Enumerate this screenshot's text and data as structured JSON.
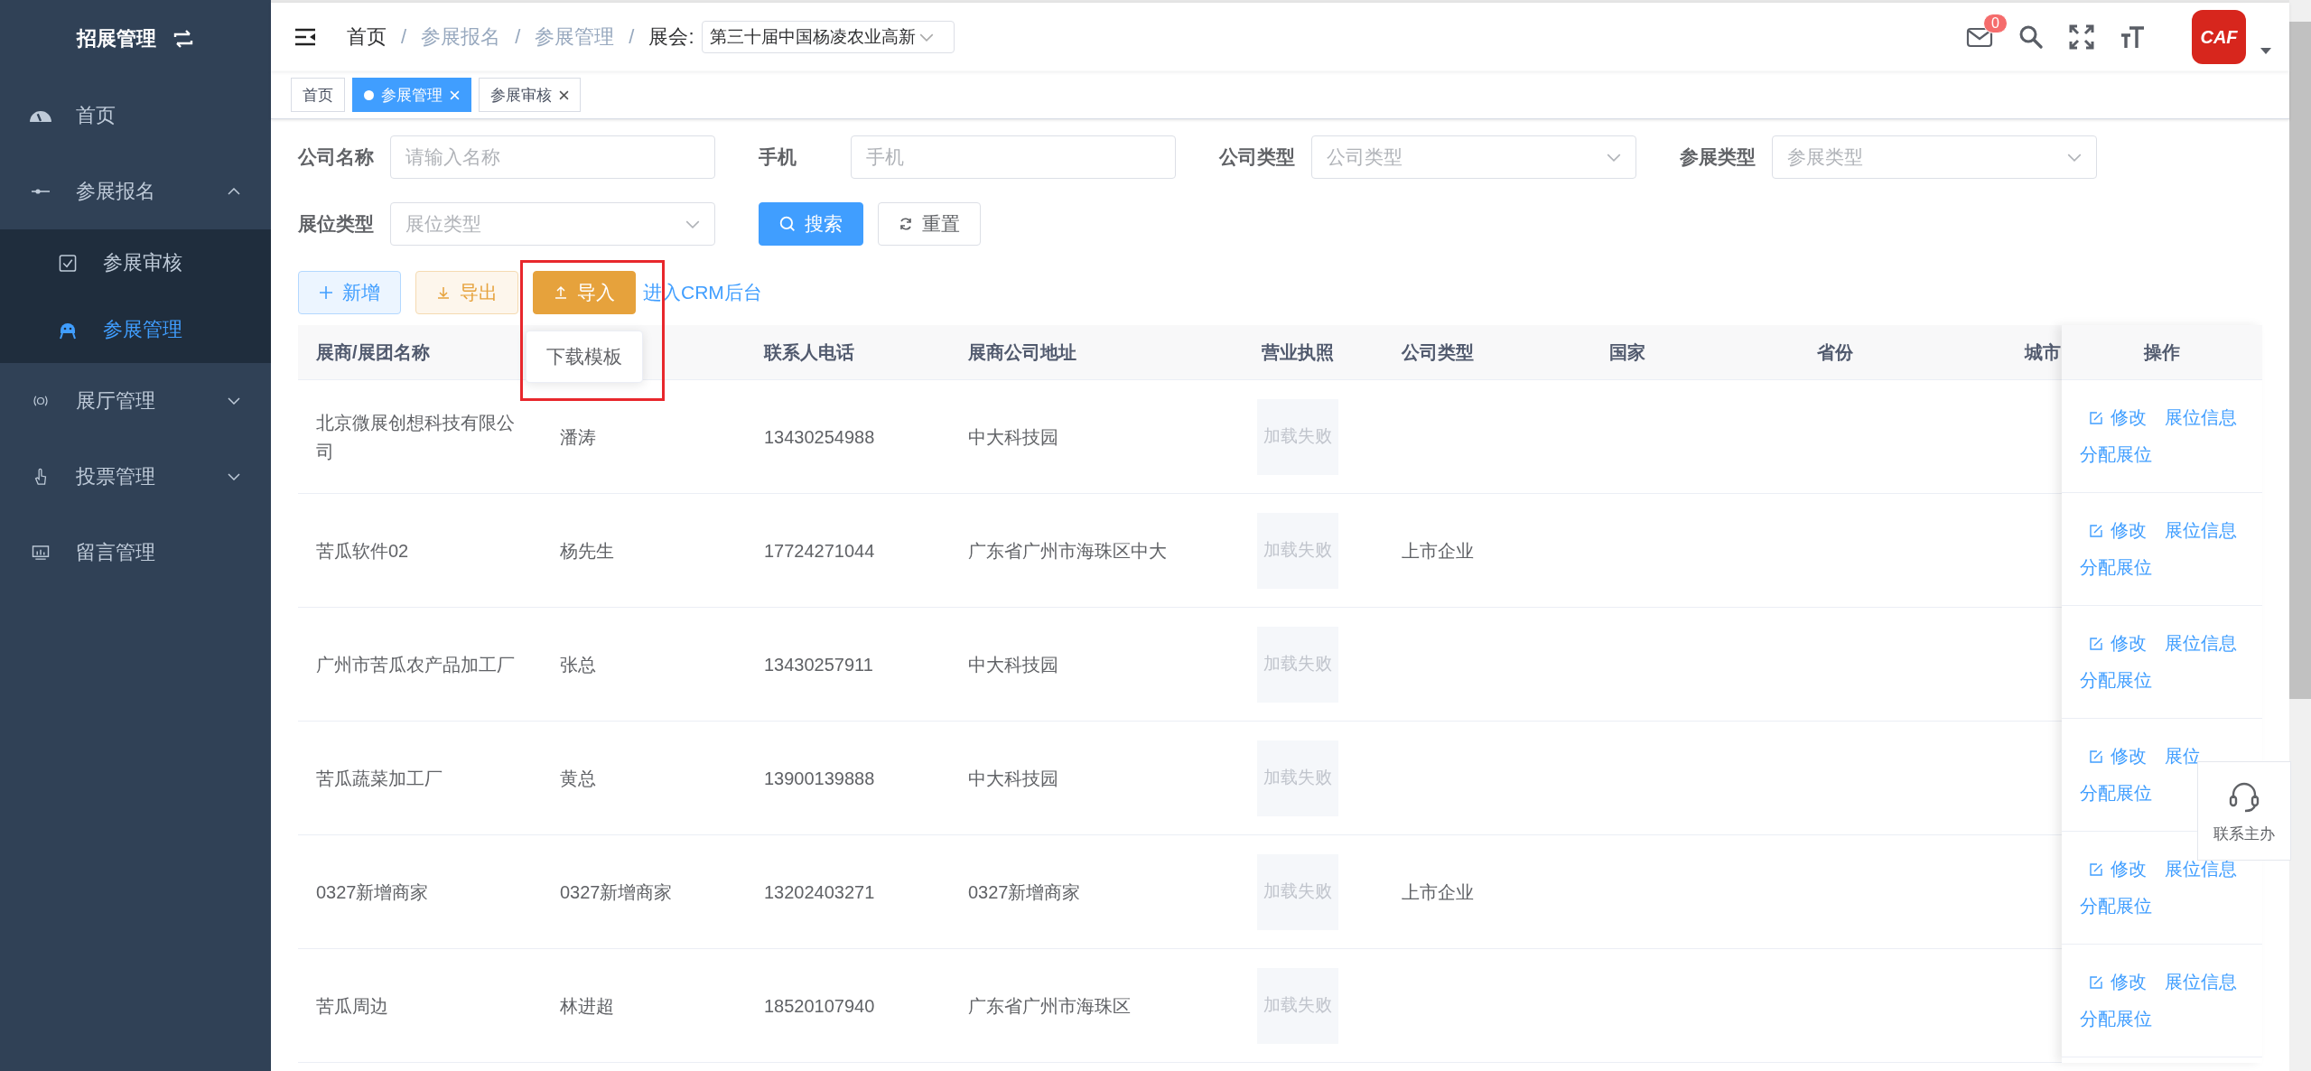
{
  "sidebar": {
    "title": "招展管理",
    "items": [
      {
        "label": "首页",
        "kind": "gauge",
        "selected": false
      },
      {
        "label": "参展报名",
        "kind": "slider",
        "selected": false,
        "expanded": true,
        "children": [
          {
            "label": "参展审核",
            "kind": "checkbox",
            "selected": false
          },
          {
            "label": "参展管理",
            "kind": "robot",
            "selected": true
          }
        ]
      },
      {
        "label": "展厅管理",
        "kind": "broadcast",
        "selected": false,
        "expanded": false
      },
      {
        "label": "投票管理",
        "kind": "hand",
        "selected": false,
        "expanded": false
      },
      {
        "label": "留言管理",
        "kind": "monitor",
        "selected": false
      }
    ]
  },
  "header": {
    "breadcrumb": [
      {
        "label": "首页",
        "muted": false
      },
      {
        "label": "参展报名",
        "muted": true
      },
      {
        "label": "参展管理",
        "muted": true
      }
    ],
    "separator": "/",
    "exhibition_label": "展会:",
    "exhibition_value": "第三十届中国杨凌农业高新",
    "notification_count": "0",
    "logo": "CAF"
  },
  "tags": [
    {
      "label": "首页",
      "selected": false,
      "closable": false
    },
    {
      "label": "参展管理",
      "selected": true,
      "closable": true
    },
    {
      "label": "参展审核",
      "selected": false,
      "closable": true
    }
  ],
  "filters": [
    {
      "label": "公司名称",
      "kind": "input",
      "placeholder": "请输入名称"
    },
    {
      "label": "手机",
      "kind": "input",
      "placeholder": "手机"
    },
    {
      "label": "公司类型",
      "kind": "select",
      "placeholder": "公司类型"
    },
    {
      "label": "参展类型",
      "kind": "select",
      "placeholder": "参展类型"
    },
    {
      "label": "展位类型",
      "kind": "select",
      "placeholder": "展位类型"
    }
  ],
  "filter_buttons": [
    {
      "label": "搜索",
      "kind": "search"
    },
    {
      "label": "重置",
      "kind": "reset"
    }
  ],
  "actions": [
    {
      "label": "新增",
      "kind": "add"
    },
    {
      "label": "导出",
      "kind": "export"
    },
    {
      "label": "导入",
      "kind": "import",
      "highlighted": true,
      "popover": "下载模板"
    },
    {
      "label": "进入CRM后台",
      "kind": "link"
    }
  ],
  "table": {
    "columns": [
      {
        "label": "展商/展团名称"
      },
      {},
      {
        "label": "联系人电话"
      },
      {
        "label": "展商公司地址"
      },
      {
        "label": "营业执照"
      },
      {
        "label": "公司类型"
      },
      {
        "label": "国家"
      },
      {
        "label": "省份"
      },
      {
        "label": "城市"
      }
    ],
    "actions_header": "操作",
    "rows": [
      {
        "name": "北京微展创想科技有限公司",
        "contact": "潘涛",
        "phone": "13430254988",
        "address": "中大科技园",
        "license": "加载失败",
        "actions": [
          "修改",
          "展位信息",
          "分配展位"
        ]
      },
      {
        "name": "苦瓜软件02",
        "contact": "杨先生",
        "phone": "17724271044",
        "address": "广东省广州市海珠区中大",
        "license": "加载失败",
        "company_type": "上市企业",
        "actions": [
          "修改",
          "展位信息",
          "分配展位"
        ]
      },
      {
        "name": "广州市苦瓜农产品加工厂",
        "contact": "张总",
        "phone": "13430257911",
        "address": "中大科技园",
        "license": "加载失败",
        "actions": [
          "修改",
          "展位信息",
          "分配展位"
        ]
      },
      {
        "name": "苦瓜蔬菜加工厂",
        "contact": "黄总",
        "phone": "13900139888",
        "address": "中大科技园",
        "license": "加载失败",
        "actions": [
          "修改",
          "展位",
          "分配展位"
        ]
      },
      {
        "name": "0327新增商家",
        "contact": "0327新增商家",
        "phone": "13202403271",
        "address": "0327新增商家",
        "license": "加载失败",
        "company_type": "上市企业",
        "actions": [
          "修改",
          "展位信息",
          "分配展位"
        ]
      },
      {
        "name": "苦瓜周边",
        "contact": "林进超",
        "phone": "18520107940",
        "address": "广东省广州市海珠区",
        "license": "加载失败",
        "actions": [
          "修改",
          "展位信息",
          "分配展位"
        ]
      }
    ]
  },
  "contact_widget": {
    "label": "联系主办"
  }
}
